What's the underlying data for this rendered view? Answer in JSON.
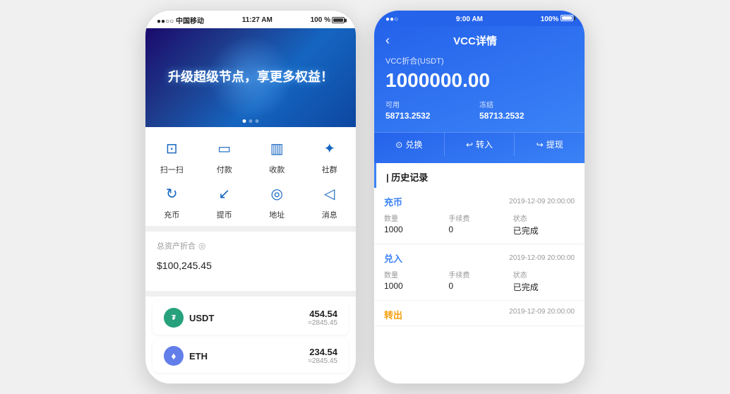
{
  "phone1": {
    "status": {
      "carrier": "●●○○ 中国移动",
      "wifi": "▾",
      "time": "11:27 AM",
      "battery_pct": "100 %"
    },
    "banner": {
      "text": "升级超级节点，享更多权益！"
    },
    "actions": [
      {
        "icon": "⊡",
        "label": "扫一扫",
        "name": "scan"
      },
      {
        "icon": "▭",
        "label": "付款",
        "name": "pay"
      },
      {
        "icon": "▥",
        "label": "收款",
        "name": "receive"
      },
      {
        "icon": "✦",
        "label": "社群",
        "name": "community"
      },
      {
        "icon": "↻",
        "label": "充币",
        "name": "recharge"
      },
      {
        "icon": "↙",
        "label": "提币",
        "name": "withdraw"
      },
      {
        "icon": "◎",
        "label": "地址",
        "name": "address"
      },
      {
        "icon": "◁",
        "label": "消息",
        "name": "message"
      }
    ],
    "assets": {
      "label": "总资产折合",
      "currency": "$",
      "amount": "100,245.45"
    },
    "coins": [
      {
        "name": "USDT",
        "type": "usdt",
        "logo": "₮",
        "amount": "454.54",
        "equiv": "≈2845.45"
      },
      {
        "name": "ETH",
        "type": "eth",
        "logo": "♦",
        "amount": "234.54",
        "equiv": "≈2845.45"
      }
    ]
  },
  "phone2": {
    "status": {
      "signal": "●●○",
      "wifi": "▾",
      "time": "9:00 AM",
      "battery_pct": "100%"
    },
    "header": {
      "back_icon": "‹",
      "title": "VCC详情",
      "subtitle": "VCC折合(USDT)",
      "balance": "1000000.00",
      "avail_label": "可用",
      "avail_value": "58713.2532",
      "frozen_label": "冻结",
      "frozen_value": "58713.2532"
    },
    "actions": [
      {
        "icon": "⊙",
        "label": "兑换",
        "name": "exchange"
      },
      {
        "icon": "↩",
        "label": "转入",
        "name": "transfer-in"
      },
      {
        "icon": "↪",
        "label": "提现",
        "name": "withdraw"
      }
    ],
    "history_title": "| 历史记录",
    "history_items": [
      {
        "type": "充币",
        "type_color": "#3b82f6",
        "time": "2019-12-09 20:00:00",
        "cols": [
          {
            "label": "数量",
            "value": "1000"
          },
          {
            "label": "手续费",
            "value": "0"
          },
          {
            "label": "状态",
            "value": "已完成"
          }
        ]
      },
      {
        "type": "兑入",
        "type_color": "#3b82f6",
        "time": "2019-12-09 20:00:00",
        "cols": [
          {
            "label": "数量",
            "value": "1000"
          },
          {
            "label": "手续费",
            "value": "0"
          },
          {
            "label": "状态",
            "value": "已完成"
          }
        ]
      }
    ],
    "partial_item": {
      "type": "转出",
      "type_color": "#f59e0b",
      "time": "2019-12-09 20:00:00"
    }
  }
}
